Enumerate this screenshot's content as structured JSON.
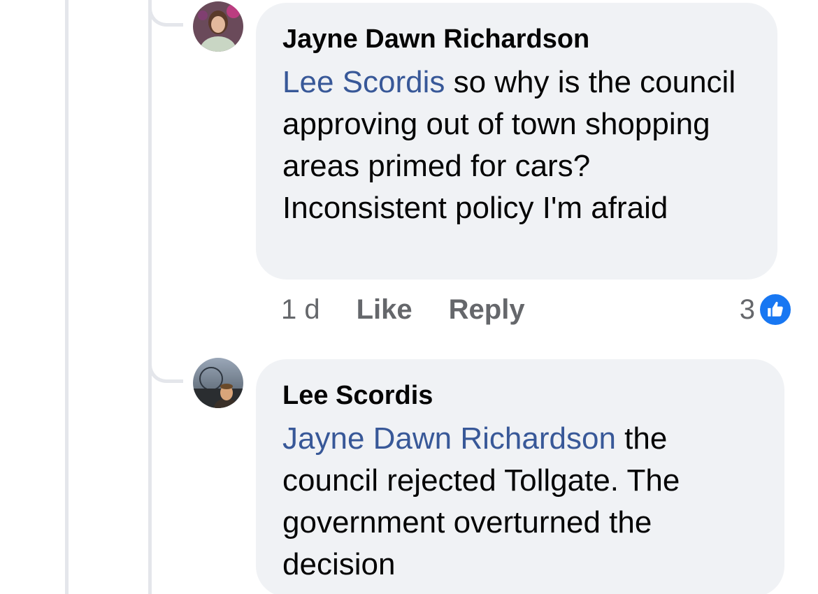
{
  "comments": [
    {
      "author": "Jayne Dawn Richardson",
      "mention": "Lee Scordis",
      "text": " so why is the council approving out of town shopping areas primed for cars? Inconsistent policy I'm afraid",
      "time": "1 d",
      "like_label": "Like",
      "reply_label": "Reply",
      "reaction_count": "3",
      "reaction_icon": "like-thumb-icon"
    },
    {
      "author": "Lee Scordis",
      "mention": "Jayne Dawn Richardson",
      "text": " the council rejected Tollgate.  The government overturned the decision"
    }
  ],
  "colors": {
    "mention": "#385898",
    "bubble": "#f0f2f5",
    "like_badge": "#1877f2",
    "thread_line": "#e4e6eb",
    "meta_text": "#65676b"
  }
}
